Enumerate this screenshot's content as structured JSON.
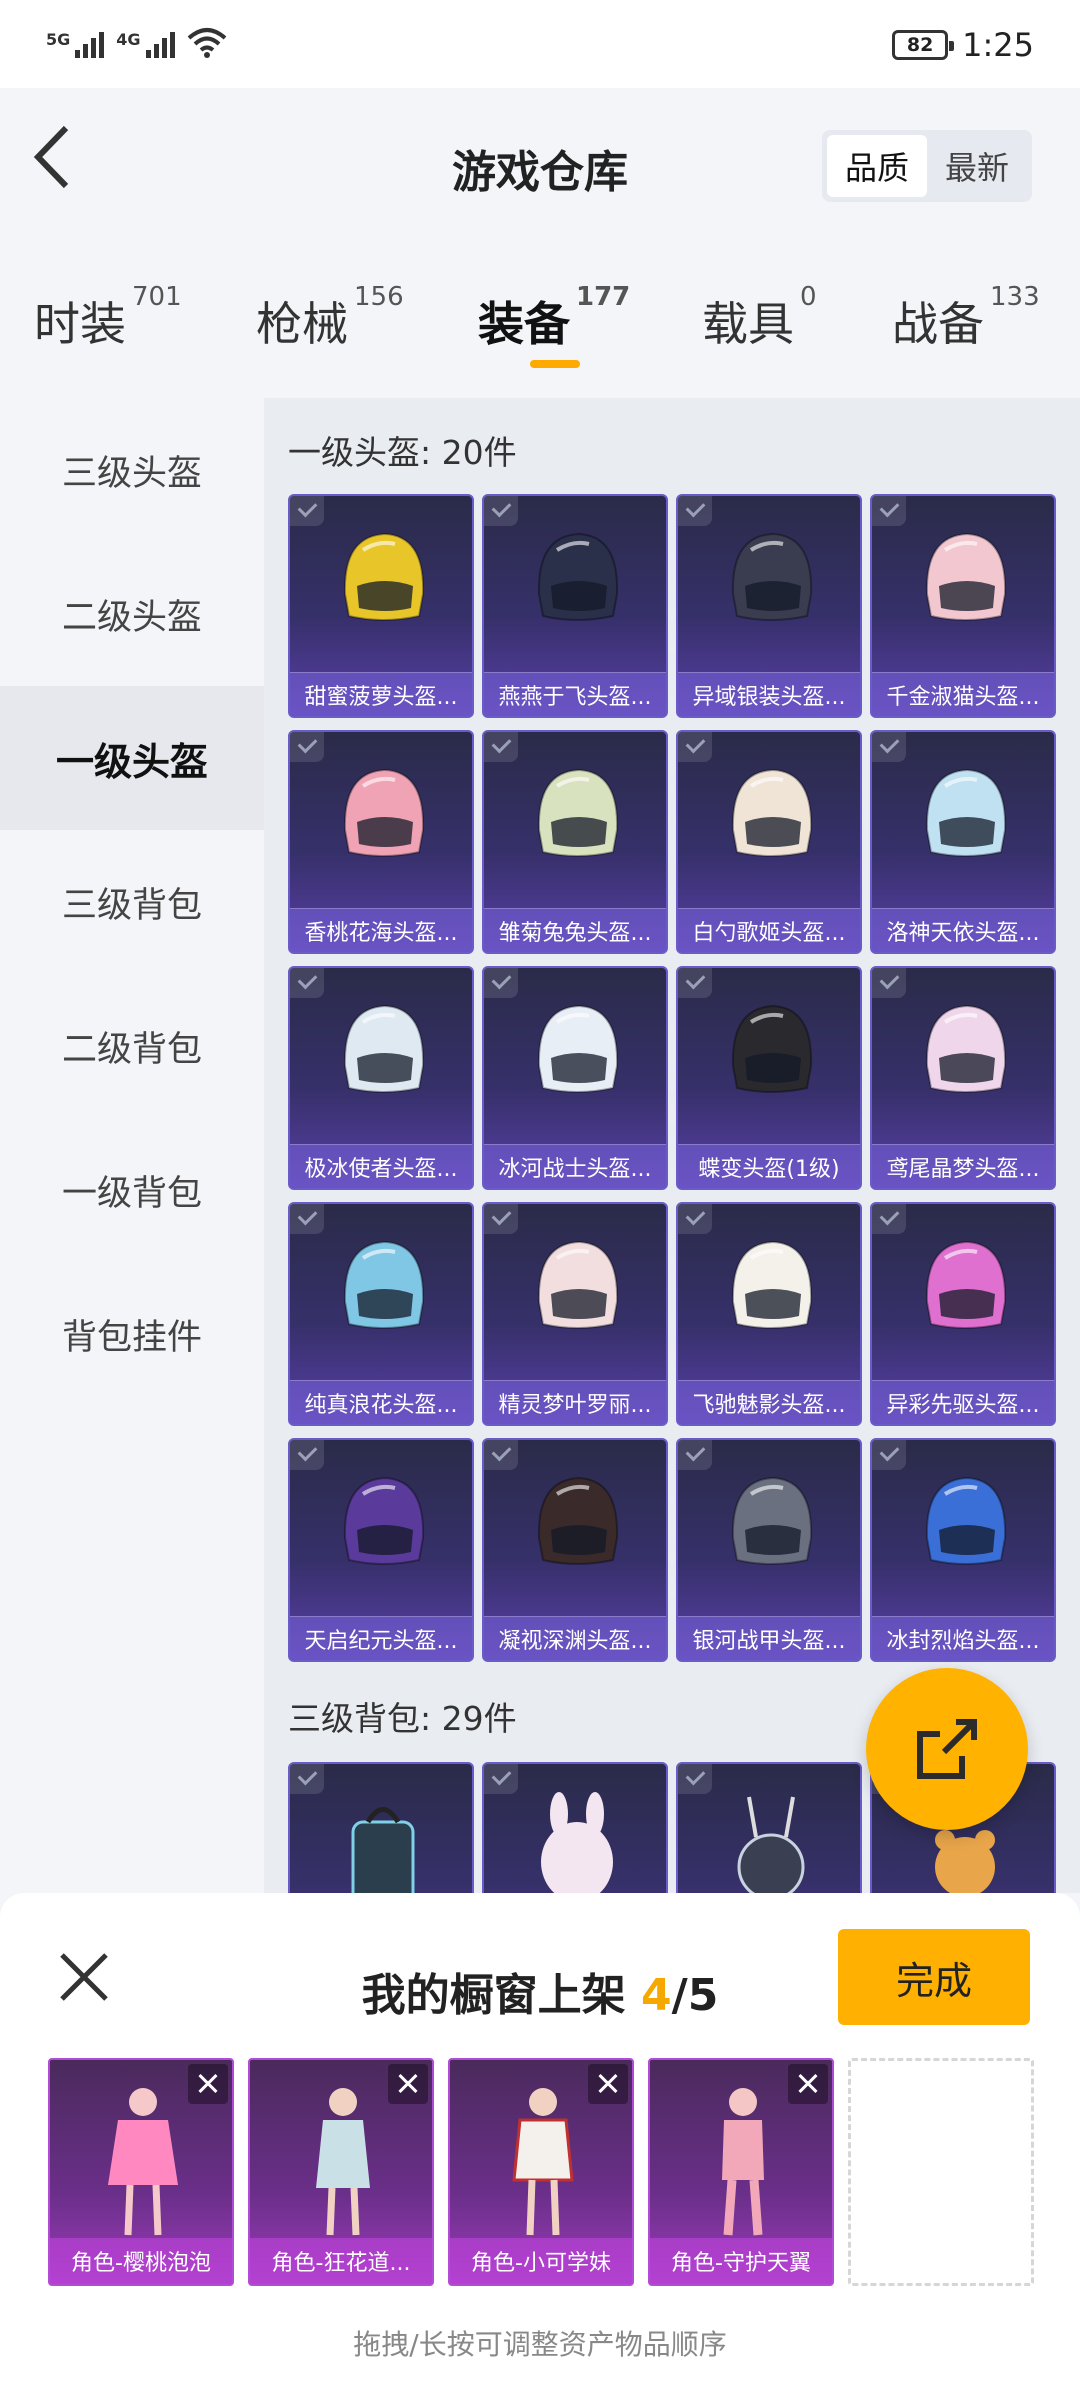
{
  "status_bar": {
    "signal1": "5G",
    "signal2": "4G",
    "battery": "82",
    "time": "1:25"
  },
  "header": {
    "title": "游戏仓库",
    "sort_quality": "品质",
    "sort_latest": "最新"
  },
  "tabs": [
    {
      "label": "时装",
      "count": "701"
    },
    {
      "label": "枪械",
      "count": "156"
    },
    {
      "label": "装备",
      "count": "177"
    },
    {
      "label": "载具",
      "count": "0"
    },
    {
      "label": "战备",
      "count": "133"
    }
  ],
  "sidebar": {
    "items": [
      {
        "label": "三级头盔"
      },
      {
        "label": "二级头盔"
      },
      {
        "label": "一级头盔"
      },
      {
        "label": "三级背包"
      },
      {
        "label": "二级背包"
      },
      {
        "label": "一级背包"
      },
      {
        "label": "背包挂件"
      }
    ]
  },
  "sections": [
    {
      "title": "一级头盔: 20件",
      "items": [
        {
          "name": "甜蜜菠萝头盔...",
          "color": "#e8c62a"
        },
        {
          "name": "燕燕于飞头盔...",
          "color": "#2a2f4a"
        },
        {
          "name": "异域银装头盔...",
          "color": "#3a3d4f"
        },
        {
          "name": "千金淑猫头盔...",
          "color": "#f2c7d0"
        },
        {
          "name": "香桃花海头盔...",
          "color": "#f0a3b4"
        },
        {
          "name": "雏菊兔兔头盔...",
          "color": "#d9e2bf"
        },
        {
          "name": "白勺歌姬头盔...",
          "color": "#efe4d6"
        },
        {
          "name": "洛神天依头盔...",
          "color": "#bfe1f1"
        },
        {
          "name": "极冰使者头盔...",
          "color": "#dfe9f2"
        },
        {
          "name": "冰河战士头盔...",
          "color": "#e8eef6"
        },
        {
          "name": "蝶变头盔(1级)",
          "color": "#2a2a2e"
        },
        {
          "name": "鸢尾晶梦头盔...",
          "color": "#f0d6ea"
        },
        {
          "name": "纯真浪花头盔...",
          "color": "#7fc7e5"
        },
        {
          "name": "精灵梦叶罗丽...",
          "color": "#f2dede"
        },
        {
          "name": "飞驰魅影头盔...",
          "color": "#f3f1ea"
        },
        {
          "name": "异彩先驱头盔...",
          "color": "#e070d0"
        },
        {
          "name": "天启纪元头盔...",
          "color": "#5a3a9a"
        },
        {
          "name": "凝视深渊头盔...",
          "color": "#3a2a2a"
        },
        {
          "name": "银河战甲头盔...",
          "color": "#6a7080"
        },
        {
          "name": "冰封烈焰头盔...",
          "color": "#3a6fd8"
        }
      ]
    },
    {
      "title": "三级背包: 29件"
    }
  ],
  "shelf": {
    "title_prefix": "我的橱窗上架 ",
    "count": "4",
    "total": "/5",
    "done": "完成",
    "items": [
      {
        "name": "角色-樱桃泡泡"
      },
      {
        "name": "角色-狂花道..."
      },
      {
        "name": "角色-小可学妹"
      },
      {
        "name": "角色-守护天翼"
      }
    ],
    "hint": "拖拽/长按可调整资产物品顺序"
  }
}
